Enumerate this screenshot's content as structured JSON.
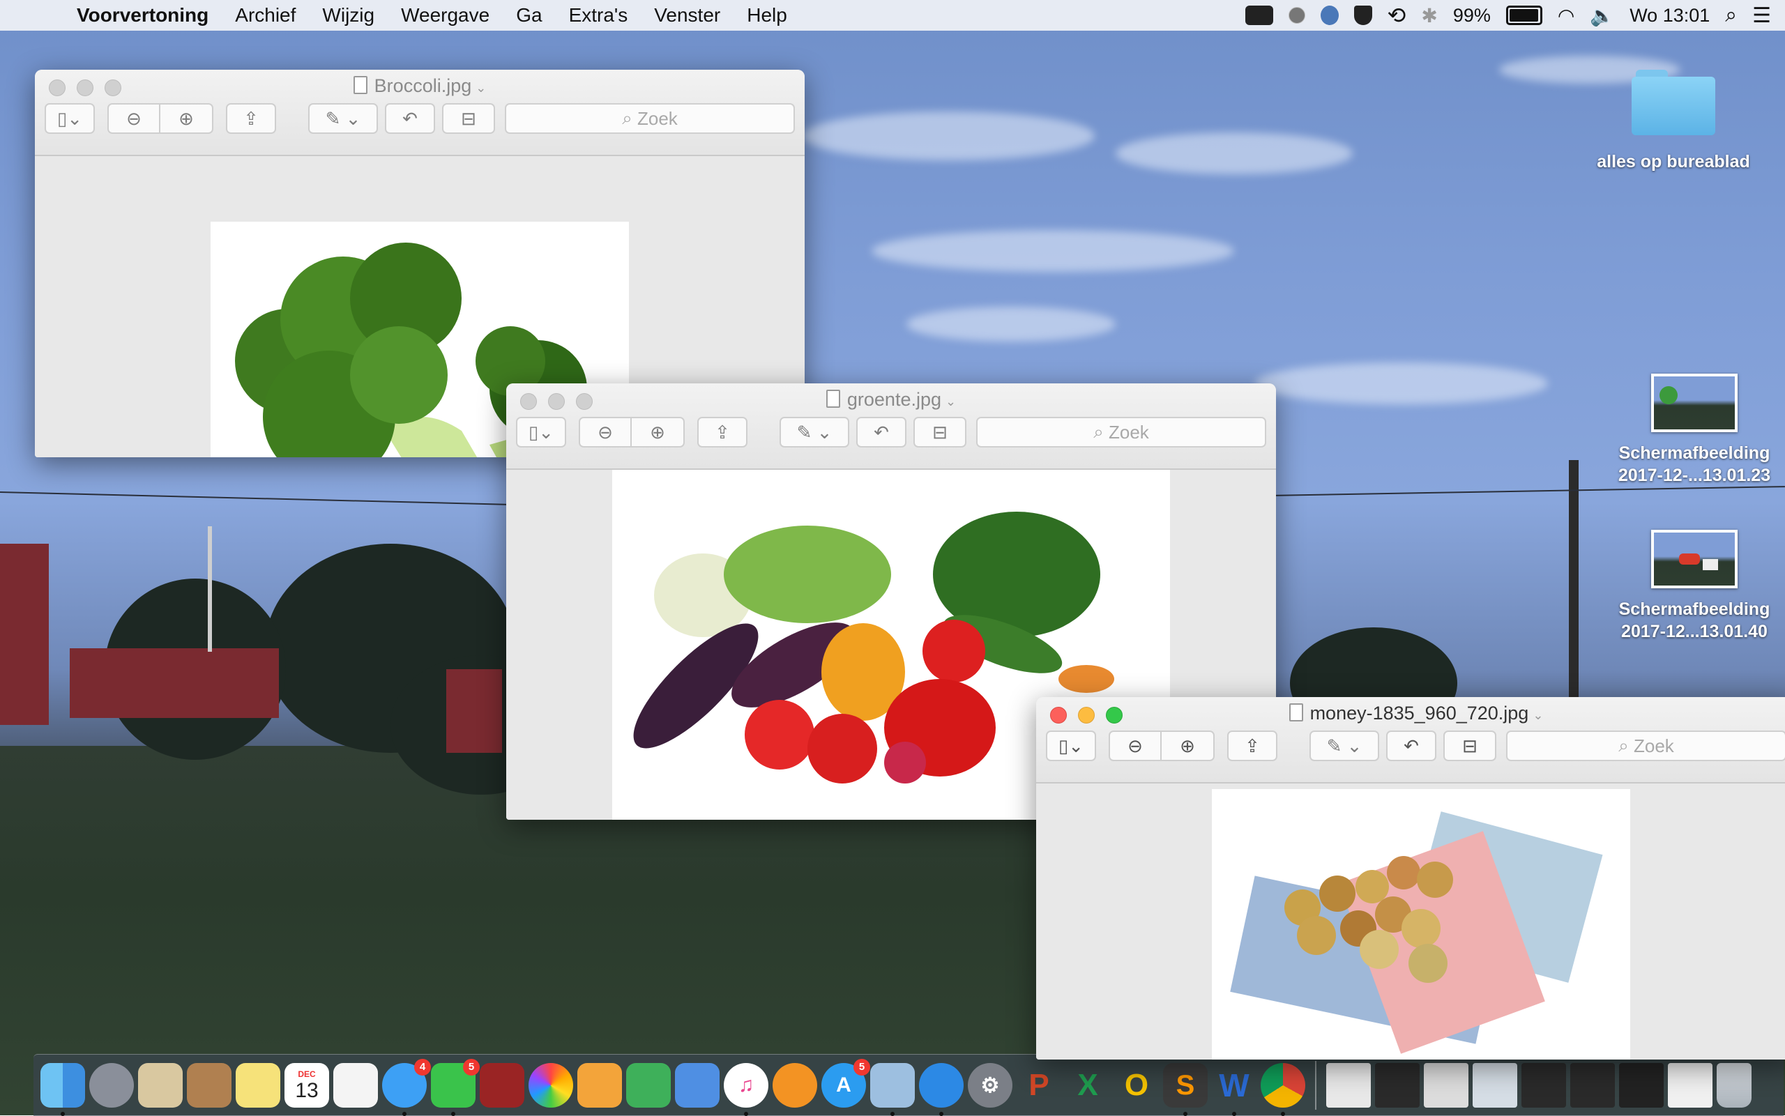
{
  "menubar": {
    "app_name": "Voorvertoning",
    "items": [
      "Archief",
      "Wijzig",
      "Weergave",
      "Ga",
      "Extra's",
      "Venster",
      "Help"
    ],
    "status": {
      "battery": "99%",
      "clock": "Wo 13:01"
    }
  },
  "windows": [
    {
      "title": "Broccoli.jpg",
      "search_placeholder": "Zoek",
      "active": false
    },
    {
      "title": "groente.jpg",
      "search_placeholder": "Zoek",
      "active": false
    },
    {
      "title": "money-1835_960_720.jpg",
      "search_placeholder": "Zoek",
      "active": true
    }
  ],
  "desktop_icons": [
    {
      "label": "alles op bureablad",
      "kind": "folder"
    },
    {
      "label_line1": "Schermafbeelding",
      "label_line2": "2017-12-...13.01.23",
      "kind": "screenshot"
    },
    {
      "label_line1": "Schermafbeelding",
      "label_line2": "2017-12...13.01.40",
      "kind": "screenshot"
    }
  ],
  "dock": {
    "calendar_month": "DEC",
    "calendar_day": "13",
    "badges": {
      "messages": "4",
      "facetime": "5",
      "appstore": "5"
    },
    "apps": [
      "finder",
      "launchpad",
      "mail-stamp",
      "contacts",
      "notes",
      "calendar",
      "reminders",
      "messages",
      "facetime",
      "photo-booth",
      "photos",
      "pages",
      "numbers",
      "keynote",
      "itunes",
      "ibooks",
      "app-store",
      "preview",
      "safari",
      "system-preferences",
      "powerpoint",
      "excel",
      "outlook",
      "sublime",
      "word",
      "chrome"
    ]
  },
  "colors": {
    "menubar_bg": "#eceef5",
    "window_bg": "#e9e9e9",
    "close": "#fc605b",
    "minimize": "#fdbc40",
    "zoom": "#34c84a"
  }
}
